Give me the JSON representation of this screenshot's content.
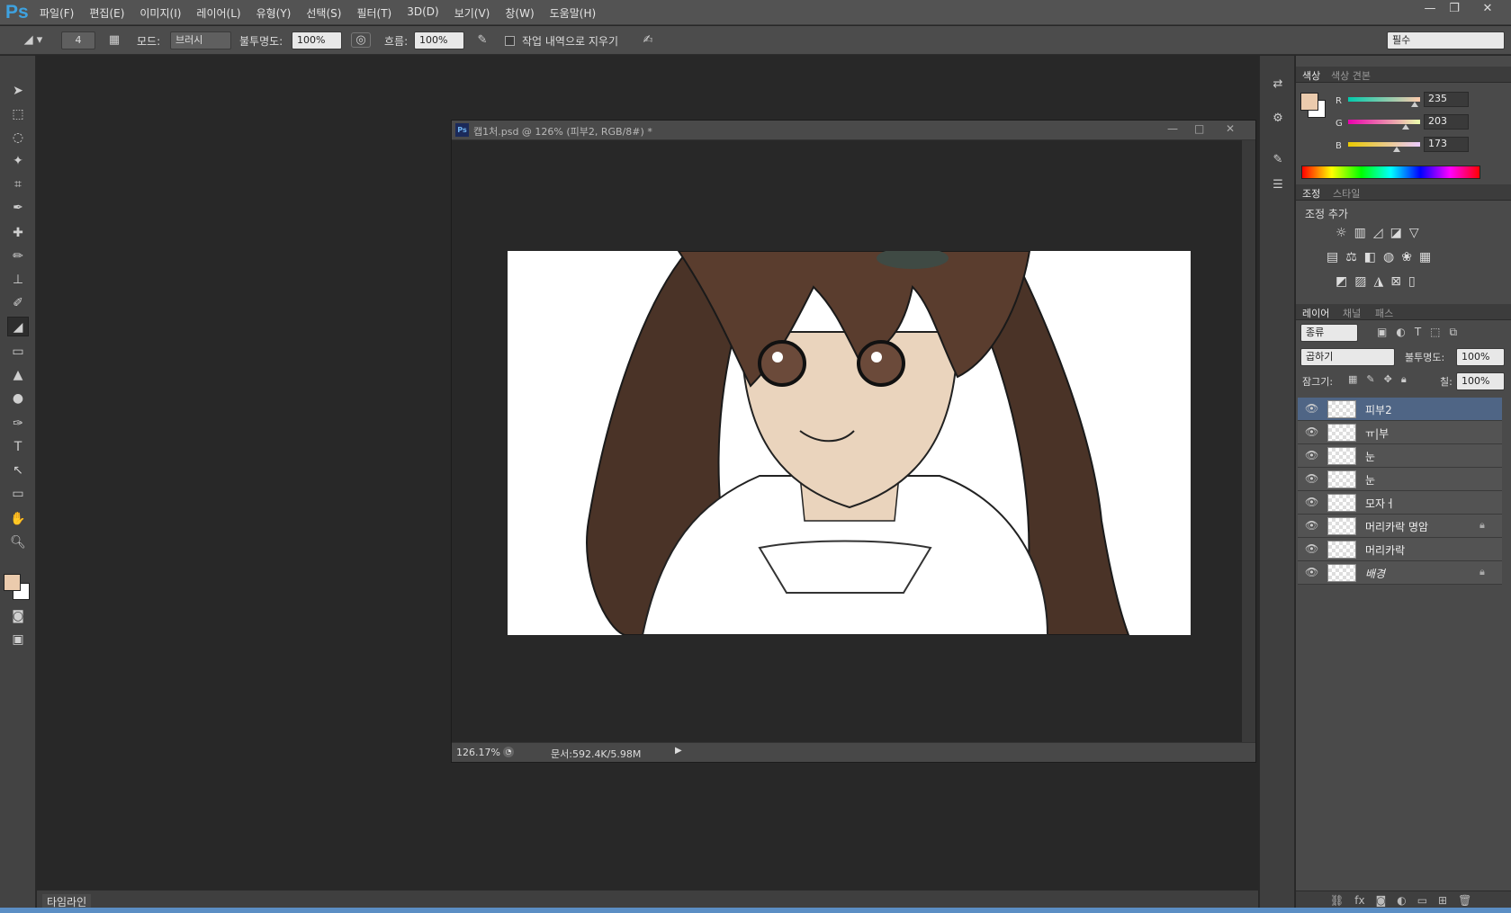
{
  "app": {
    "logo": "Ps",
    "menus": [
      "파일(F)",
      "편집(E)",
      "이미지(I)",
      "레이어(L)",
      "유형(Y)",
      "선택(S)",
      "필터(T)",
      "3D(D)",
      "보기(V)",
      "창(W)",
      "도움말(H)"
    ],
    "win_min": "—",
    "win_restore": "❐",
    "win_close": "✕"
  },
  "options": {
    "brush_size": "4",
    "mode_label": "모드:",
    "mode_value": "브러시",
    "opacity_label": "불투명도:",
    "opacity_value": "100%",
    "flow_label": "흐름:",
    "flow_value": "100%",
    "erase_history_label": "작업 내역으로 지우기",
    "workspace": "필수"
  },
  "document": {
    "title": "캡1처.psd @ 126% (피부2, RGB/8#) *",
    "zoom": "126.17%",
    "doc_info": "문서:592.4K/5.98M",
    "ps_badge": "Ps"
  },
  "color_panel": {
    "tabs": [
      "색상",
      "색상 견본"
    ],
    "channels": [
      {
        "label": "R",
        "value": "235",
        "pos": 0.92
      },
      {
        "label": "G",
        "value": "203",
        "pos": 0.8
      },
      {
        "label": "B",
        "value": "173",
        "pos": 0.68
      }
    ],
    "fg": "#ebcbad",
    "bg": "#ffffff"
  },
  "adjust_panel": {
    "tabs": [
      "조정",
      "스타일"
    ],
    "title": "조정 추가"
  },
  "layers_panel": {
    "tabs": [
      "레이어",
      "채널",
      "패스"
    ],
    "filter": "종류",
    "blend": "곱하기",
    "opacity_label": "불투명도:",
    "opacity": "100%",
    "lock_label": "잠그기:",
    "fill_label": "칠:",
    "fill": "100%",
    "layers": [
      {
        "name": "피부2",
        "locked": false,
        "selected": true
      },
      {
        "name": "ㅠ|부",
        "locked": false
      },
      {
        "name": "눈",
        "locked": false
      },
      {
        "name": "눈",
        "locked": false
      },
      {
        "name": "모자ㅓ",
        "locked": false
      },
      {
        "name": "머리카락 명암",
        "locked": true
      },
      {
        "name": "머리카락",
        "locked": false
      },
      {
        "name": "배경",
        "locked": true
      }
    ]
  },
  "timeline": {
    "label": "타임라인"
  }
}
